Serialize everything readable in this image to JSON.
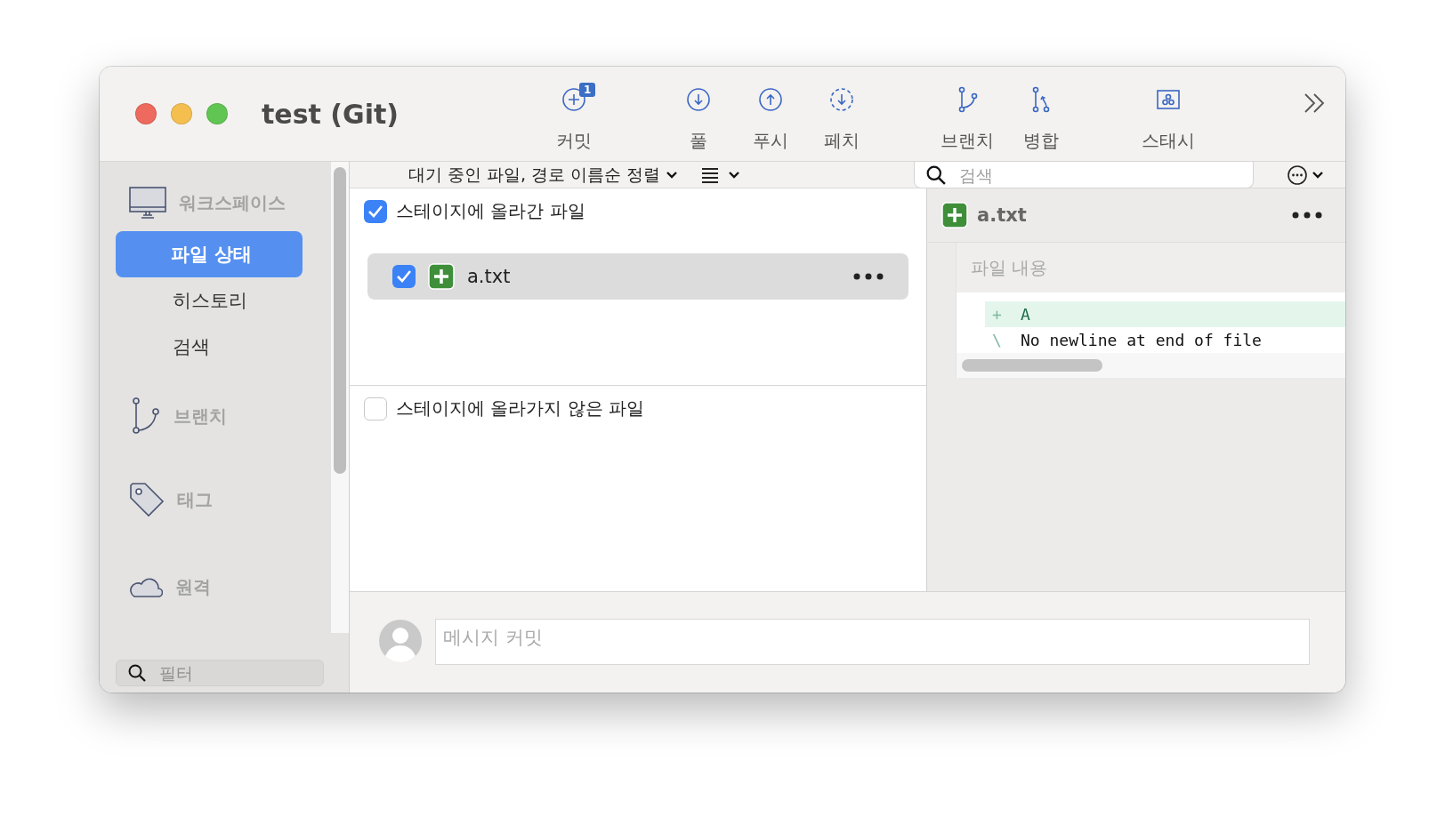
{
  "window": {
    "title": "test (Git)"
  },
  "toolbar": {
    "items": [
      {
        "kind": "commit",
        "label": "커밋",
        "badge": "1"
      },
      {
        "kind": "pull",
        "label": "풀"
      },
      {
        "kind": "push",
        "label": "푸시"
      },
      {
        "kind": "fetch",
        "label": "페치"
      },
      {
        "kind": "branch",
        "label": "브랜치"
      },
      {
        "kind": "merge",
        "label": "병합"
      },
      {
        "kind": "stash",
        "label": "스태시"
      }
    ]
  },
  "sidebar": {
    "sections": [
      {
        "kind": "workspace",
        "label": "워크스페이스",
        "items": [
          {
            "label": "파일 상태",
            "selected": true
          },
          {
            "label": "히스토리",
            "selected": false
          },
          {
            "label": "검색",
            "selected": false
          }
        ]
      },
      {
        "kind": "branches",
        "label": "브랜치"
      },
      {
        "kind": "tags",
        "label": "태그"
      },
      {
        "kind": "remotes",
        "label": "원격"
      }
    ],
    "filter": {
      "placeholder": "필터"
    }
  },
  "file_bar": {
    "sort_label": "대기 중인 파일, 경로 이름순 정렬",
    "search": {
      "placeholder": "검색"
    }
  },
  "staged": {
    "label": "스테이지에 올라간 파일",
    "checked": true,
    "files": [
      {
        "name": "a.txt",
        "checked": true,
        "selected": true
      }
    ]
  },
  "unstaged": {
    "label": "스테이지에 올라가지 않은 파일",
    "checked": false
  },
  "diff": {
    "file": "a.txt",
    "hunk_header": "파일 내용",
    "lines": [
      {
        "kind": "add",
        "sign": "+",
        "text": "A"
      },
      {
        "kind": "note",
        "sign": "\\",
        "text": "No newline at end of file"
      }
    ]
  },
  "commit": {
    "placeholder": "메시지 커밋"
  }
}
